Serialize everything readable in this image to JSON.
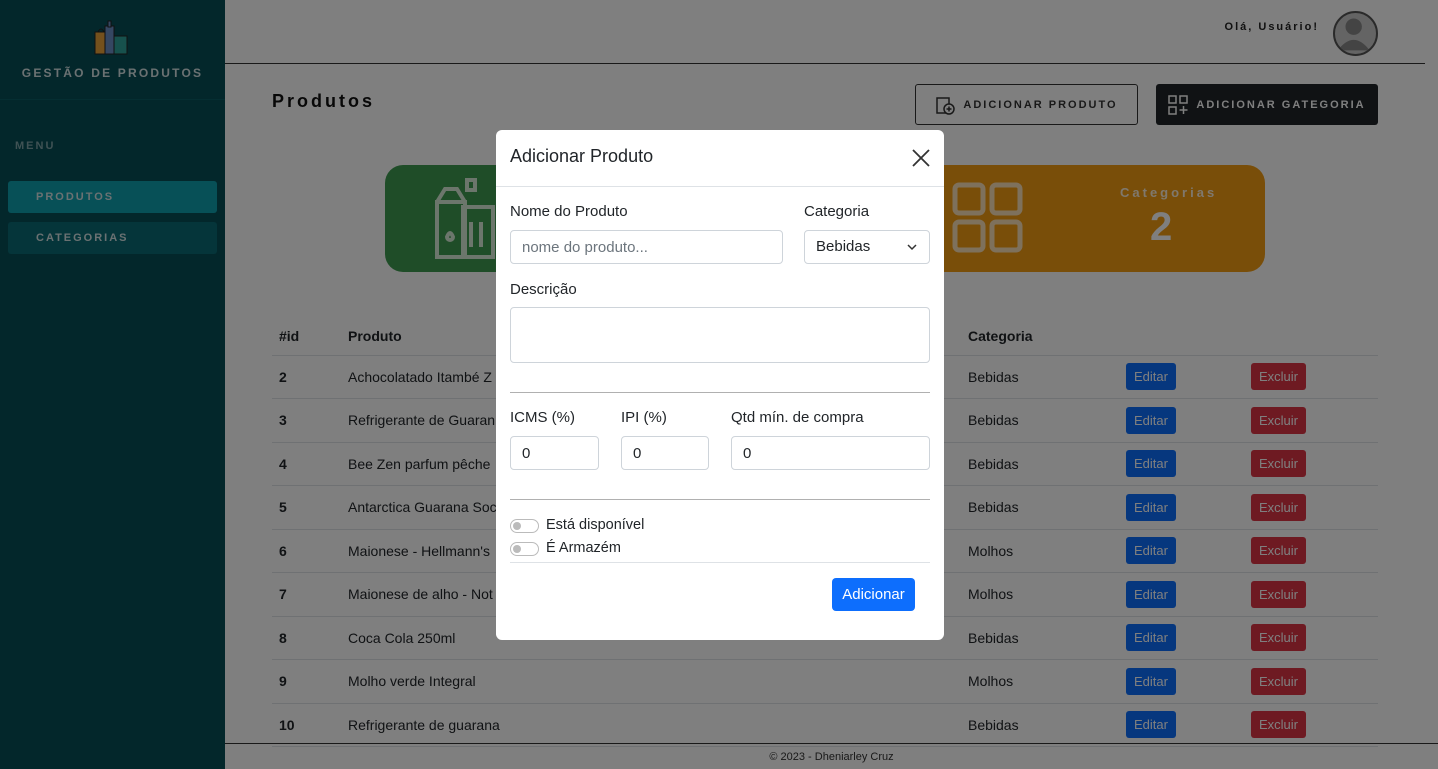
{
  "sidebar": {
    "brand_title": "GESTÃO DE PRODUTOS",
    "menu_label": "MENU",
    "items": [
      {
        "label": "PRODUTOS"
      },
      {
        "label": "CATEGORIAS"
      }
    ]
  },
  "header": {
    "greeting": "Olá, Usuário!"
  },
  "main": {
    "title": "Produtos",
    "add_product_label": "ADICIONAR PRODUTO",
    "add_category_label": "ADICIONAR GATEGORIA",
    "stats": {
      "categories_label": "Categorias",
      "categories_value": "2"
    },
    "table": {
      "columns": [
        "#id",
        "Produto",
        "Categoria"
      ],
      "edit_label": "Editar",
      "delete_label": "Excluir",
      "rows": [
        {
          "id": "2",
          "product": "Achocolatado Itambé Z",
          "category": "Bebidas"
        },
        {
          "id": "3",
          "product": "Refrigerante de Guaran",
          "category": "Bebidas"
        },
        {
          "id": "4",
          "product": "Bee Zen parfum pêche",
          "category": "Bebidas"
        },
        {
          "id": "5",
          "product": "Antarctica Guarana Soc",
          "category": "Bebidas"
        },
        {
          "id": "6",
          "product": "Maionese - Hellmann's",
          "category": "Molhos"
        },
        {
          "id": "7",
          "product": "Maionese de alho - Not",
          "category": "Molhos"
        },
        {
          "id": "8",
          "product": "Coca Cola 250ml",
          "category": "Bebidas"
        },
        {
          "id": "9",
          "product": "Molho verde Integral",
          "category": "Molhos"
        },
        {
          "id": "10",
          "product": "Refrigerante de guarana",
          "category": "Bebidas"
        }
      ]
    }
  },
  "footer": {
    "text": "© 2023 - Dheniarley Cruz"
  },
  "modal": {
    "title": "Adicionar Produto",
    "name_label": "Nome do Produto",
    "name_placeholder": "nome do produto...",
    "category_label": "Categoria",
    "category_selected": "Bebidas",
    "description_label": "Descrição",
    "icms_label": "ICMS (%)",
    "icms_value": "0",
    "ipi_label": "IPI (%)",
    "ipi_value": "0",
    "qtd_label": "Qtd mín. de compra",
    "qtd_value": "0",
    "available_label": "Está disponível",
    "warehouse_label": "É Armazém",
    "submit_label": "Adicionar"
  },
  "colors": {
    "sidebar": "#074f57",
    "active_menu": "#0fa0af",
    "green_card": "#3f9b50",
    "orange_card": "#f39c12",
    "primary": "#0d6efd",
    "danger": "#dc3545"
  }
}
